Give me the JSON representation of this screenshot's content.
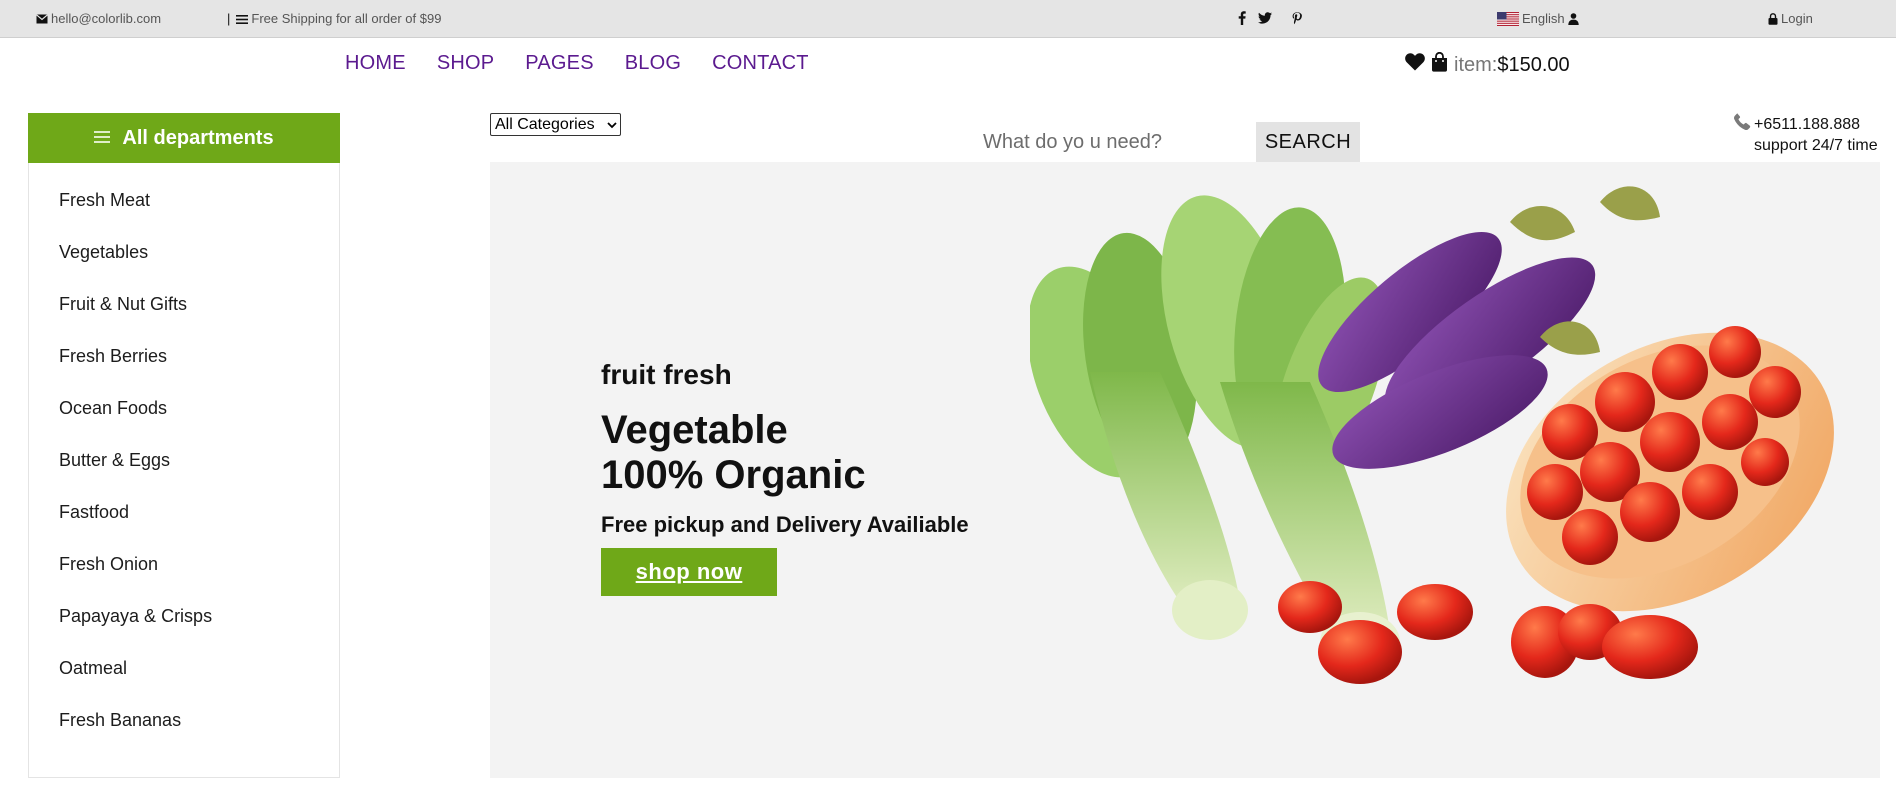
{
  "topbar": {
    "email": "hello@colorlib.com",
    "separator": "|",
    "shipping": "Free Shipping for all order of $99",
    "language": "English",
    "login": "Login"
  },
  "nav": {
    "items": [
      "HOME",
      "SHOP",
      "PAGES",
      "BLOG",
      "CONTACT"
    ]
  },
  "cart": {
    "label": "item:",
    "price": "$150.00"
  },
  "departments": {
    "title": "All departments",
    "items": [
      "Fresh Meat",
      "Vegetables",
      "Fruit & Nut Gifts",
      "Fresh Berries",
      "Ocean Foods",
      "Butter & Eggs",
      "Fastfood",
      "Fresh Onion",
      "Papayaya & Crisps",
      "Oatmeal",
      "Fresh Bananas"
    ]
  },
  "search": {
    "category": "All Categories",
    "placeholder": "What do yo u need?",
    "button": "SEARCH"
  },
  "phone": {
    "number": "+6511.188.888",
    "support": "support 24/7 time"
  },
  "hero": {
    "subtitle": "fruit fresh",
    "title_line1": "Vegetable",
    "title_line2": "100% Organic",
    "description": "Free pickup and Delivery Availiable",
    "button": "shop now"
  },
  "colors": {
    "accent": "#6fa818",
    "nav_link": "#5b1a8f",
    "topbar_bg": "#e5e5e5",
    "hero_bg": "#f3f3f3"
  },
  "icons": [
    "envelope-icon",
    "menu-icon",
    "facebook-icon",
    "twitter-icon",
    "pinterest-icon",
    "us-flag-icon",
    "user-icon",
    "lock-icon",
    "heart-icon",
    "shopping-bag-icon",
    "hamburger-icon",
    "phone-icon",
    "chevron-down-icon"
  ]
}
